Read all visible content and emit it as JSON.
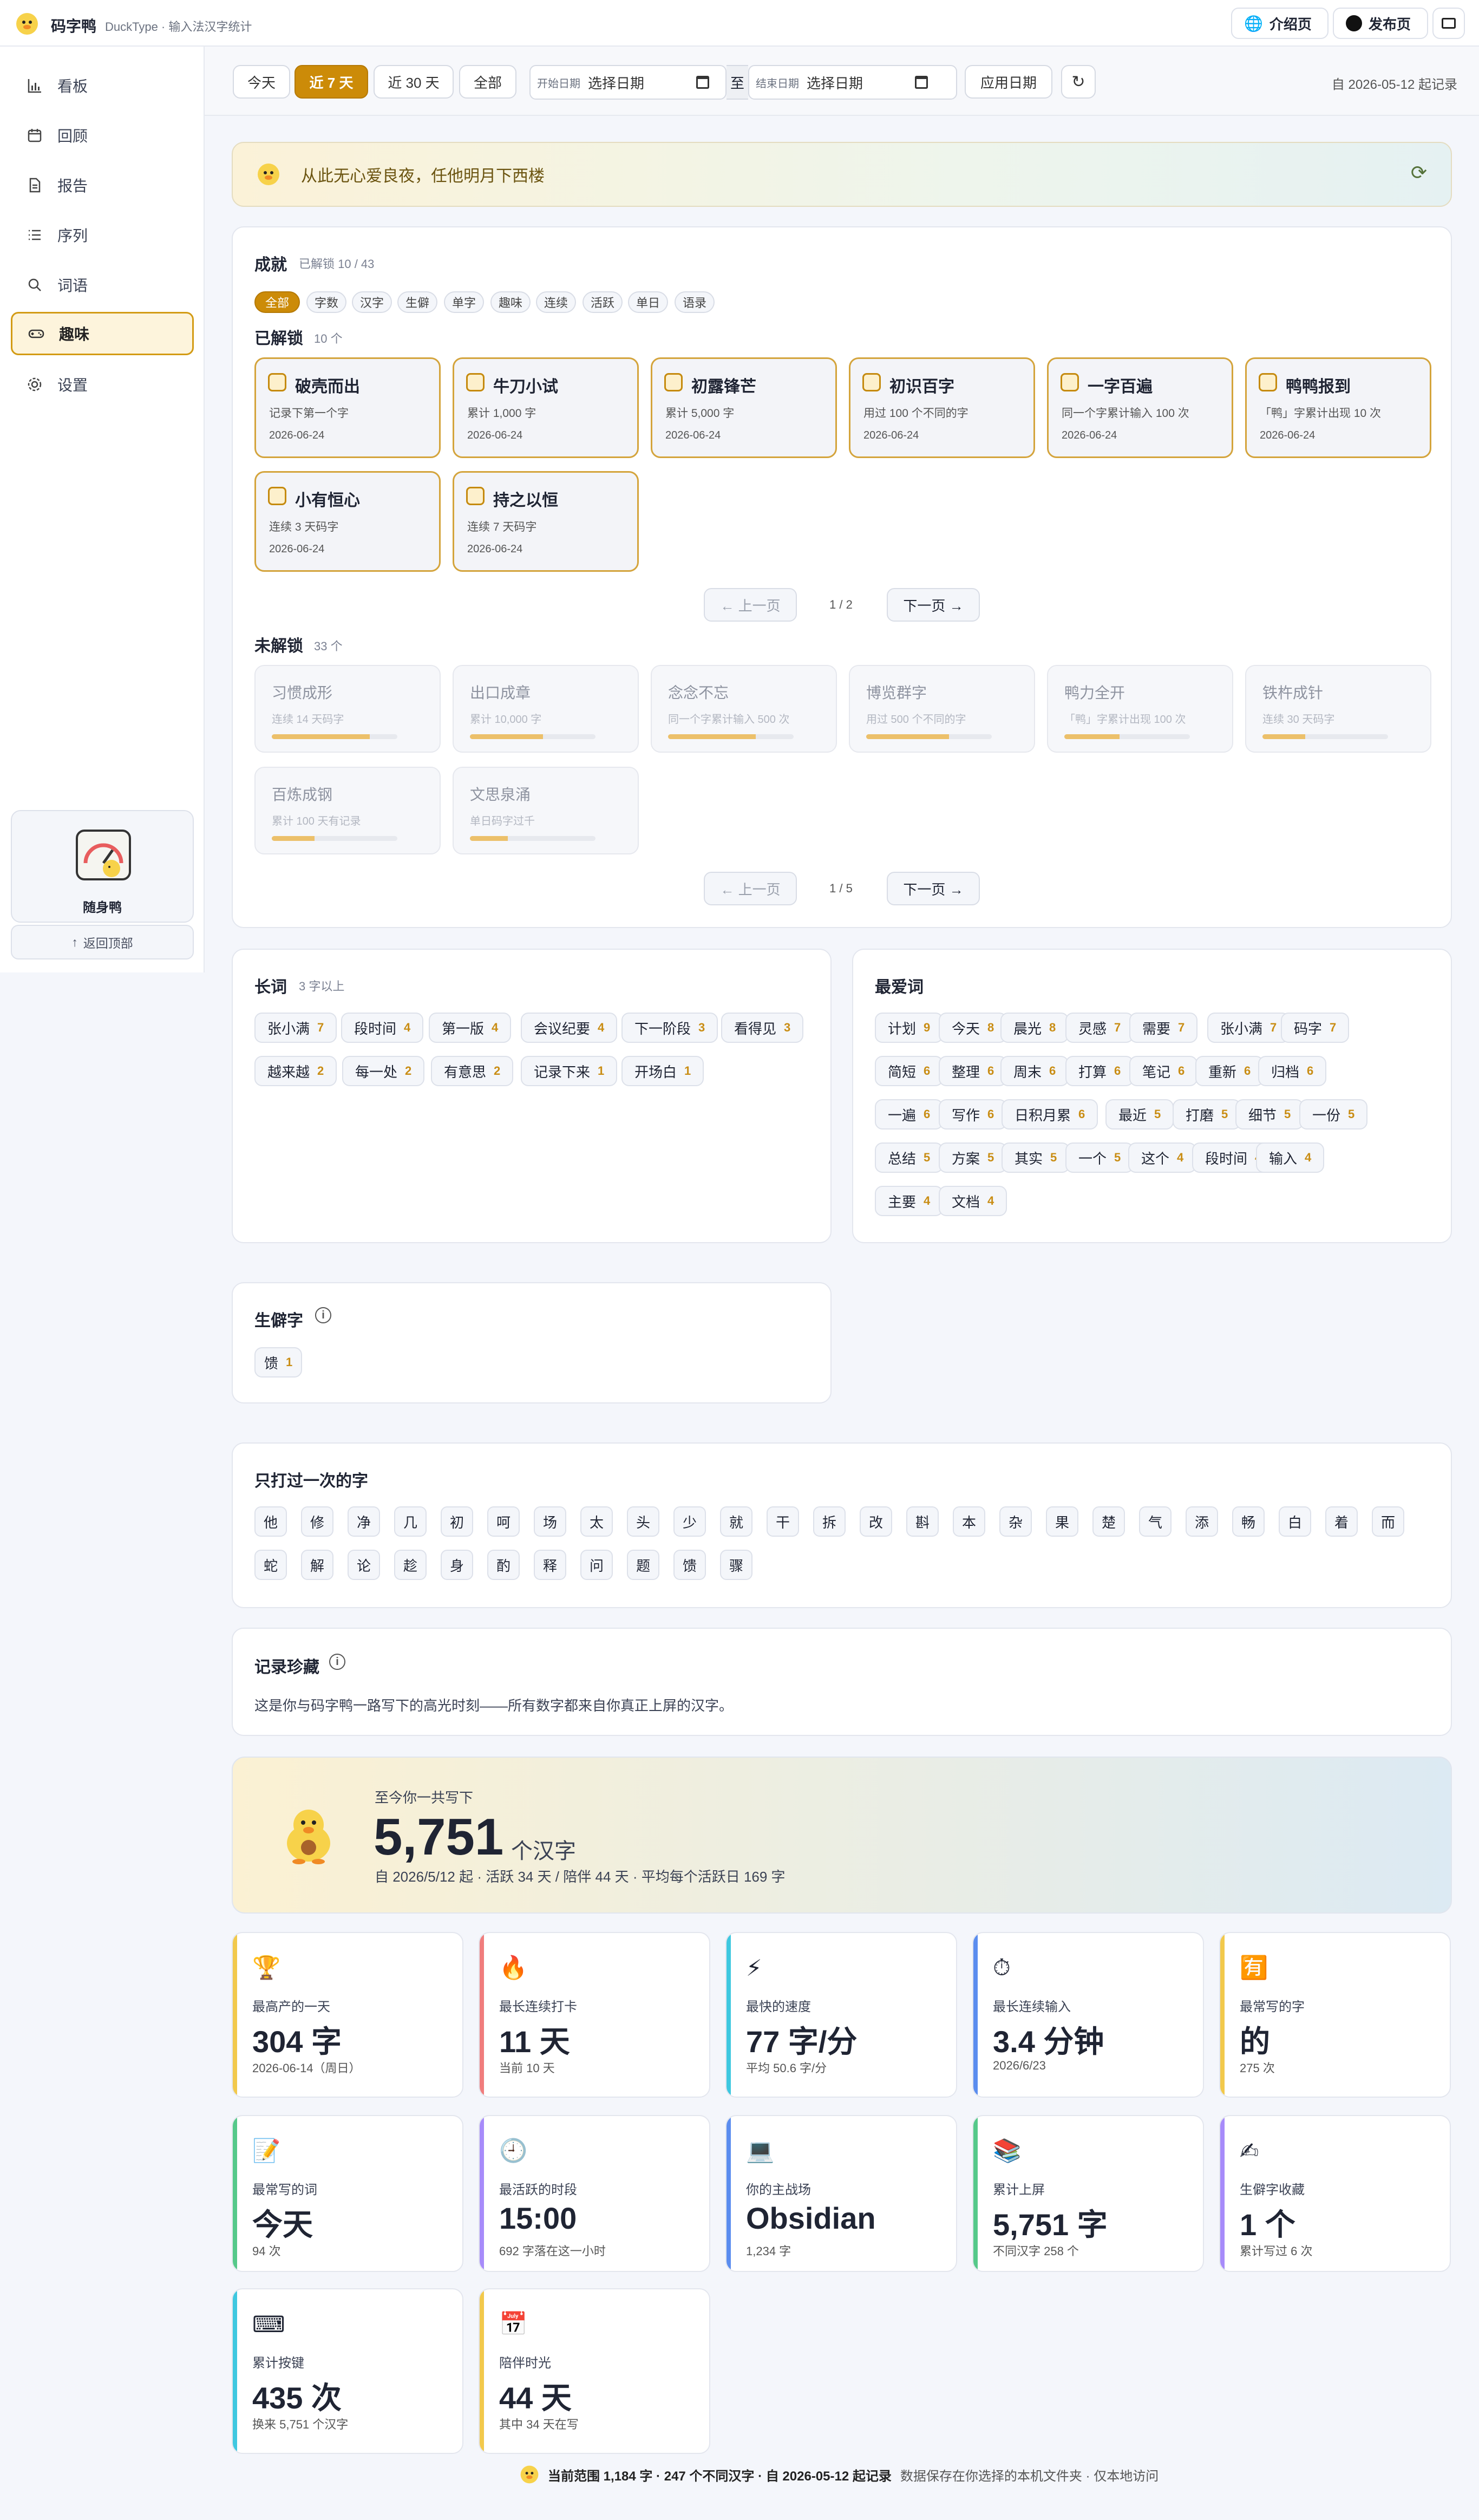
{
  "app": {
    "title": "码字鸭",
    "subtitle": "DuckType · 输入法汉字统计"
  },
  "topbar": {
    "intro_label": "介绍页",
    "release_label": "发布页"
  },
  "sidebar": {
    "items": [
      {
        "label": "看板",
        "icon": "bar-chart-icon"
      },
      {
        "label": "回顾",
        "icon": "calendar-icon"
      },
      {
        "label": "报告",
        "icon": "document-icon"
      },
      {
        "label": "序列",
        "icon": "list-icon"
      },
      {
        "label": "词语",
        "icon": "search-icon"
      },
      {
        "label": "趣味",
        "icon": "gamepad-icon"
      },
      {
        "label": "设置",
        "icon": "gear-icon"
      }
    ],
    "active": "趣味",
    "duck_card_label": "随身鸭",
    "back_top_label": "返回顶部"
  },
  "filters": {
    "buttons": [
      "今天",
      "近 7 天",
      "近 30 天",
      "全部"
    ],
    "active": "近 7 天",
    "start_label": "开始日期",
    "start_value": "选择日期",
    "sep": "至",
    "end_label": "结束日期",
    "end_value": "选择日期",
    "apply_label": "应用日期",
    "since": "自 2026-05-12 起记录"
  },
  "quote": "从此无心爱良夜，任他明月下西楼",
  "achievements": {
    "title": "成就",
    "summary": "已解锁 10 / 43",
    "tags": [
      "全部",
      "字数",
      "汉字",
      "生僻",
      "单字",
      "趣味",
      "连续",
      "活跃",
      "单日",
      "语录"
    ],
    "unlocked_title": "已解锁",
    "unlocked_count": "10 个",
    "unlocked": [
      {
        "title": "破壳而出",
        "desc": "记录下第一个字",
        "date": "2026-06-24"
      },
      {
        "title": "牛刀小试",
        "desc": "累计 1,000 字",
        "date": "2026-06-24"
      },
      {
        "title": "初露锋芒",
        "desc": "累计 5,000 字",
        "date": "2026-06-24"
      },
      {
        "title": "初识百字",
        "desc": "用过 100 个不同的字",
        "date": "2026-06-24"
      },
      {
        "title": "一字百遍",
        "desc": "同一个字累计输入 100 次",
        "date": "2026-06-24"
      },
      {
        "title": "鸭鸭报到",
        "desc": "「鸭」字累计出现 10 次",
        "date": "2026-06-24"
      },
      {
        "title": "小有恒心",
        "desc": "连续 3 天码字",
        "date": "2026-06-24"
      },
      {
        "title": "持之以恒",
        "desc": "连续 7 天码字",
        "date": "2026-06-24"
      }
    ],
    "unlocked_page": "1 / 2",
    "locked_title": "未解锁",
    "locked_count": "33 个",
    "locked": [
      {
        "title": "习惯成形",
        "desc": "连续 14 天码字",
        "progress": 0.78
      },
      {
        "title": "出口成章",
        "desc": "累计 10,000 字",
        "progress": 0.58
      },
      {
        "title": "念念不忘",
        "desc": "同一个字累计输入 500 次",
        "progress": 0.7
      },
      {
        "title": "博览群字",
        "desc": "用过 500 个不同的字",
        "progress": 0.66
      },
      {
        "title": "鸭力全开",
        "desc": "「鸭」字累计出现 100 次",
        "progress": 0.44
      },
      {
        "title": "铁杵成针",
        "desc": "连续 30 天码字",
        "progress": 0.34
      },
      {
        "title": "百炼成钢",
        "desc": "累计 100 天有记录",
        "progress": 0.34
      },
      {
        "title": "文思泉涌",
        "desc": "单日码字过千",
        "progress": 0.3
      }
    ],
    "locked_page": "1 / 5",
    "prev_label": "← 上一页",
    "next_label": "下一页 →"
  },
  "long_words": {
    "title": "长词",
    "subtitle": "3 字以上",
    "items": [
      {
        "w": "张小满",
        "n": "7"
      },
      {
        "w": "段时间",
        "n": "4"
      },
      {
        "w": "第一版",
        "n": "4"
      },
      {
        "w": "会议纪要",
        "n": "4"
      },
      {
        "w": "下一阶段",
        "n": "3"
      },
      {
        "w": "看得见",
        "n": "3"
      },
      {
        "w": "越来越",
        "n": "2"
      },
      {
        "w": "每一处",
        "n": "2"
      },
      {
        "w": "有意思",
        "n": "2"
      },
      {
        "w": "记录下来",
        "n": "1"
      },
      {
        "w": "开场白",
        "n": "1"
      }
    ]
  },
  "fav_words": {
    "title": "最爱词",
    "items": [
      {
        "w": "计划",
        "n": "9"
      },
      {
        "w": "今天",
        "n": "8"
      },
      {
        "w": "晨光",
        "n": "8"
      },
      {
        "w": "灵感",
        "n": "7"
      },
      {
        "w": "需要",
        "n": "7"
      },
      {
        "w": "张小满",
        "n": "7"
      },
      {
        "w": "码字",
        "n": "7"
      },
      {
        "w": "简短",
        "n": "6"
      },
      {
        "w": "整理",
        "n": "6"
      },
      {
        "w": "周末",
        "n": "6"
      },
      {
        "w": "打算",
        "n": "6"
      },
      {
        "w": "笔记",
        "n": "6"
      },
      {
        "w": "重新",
        "n": "6"
      },
      {
        "w": "归档",
        "n": "6"
      },
      {
        "w": "一遍",
        "n": "6"
      },
      {
        "w": "写作",
        "n": "6"
      },
      {
        "w": "日积月累",
        "n": "6"
      },
      {
        "w": "最近",
        "n": "5"
      },
      {
        "w": "打磨",
        "n": "5"
      },
      {
        "w": "细节",
        "n": "5"
      },
      {
        "w": "一份",
        "n": "5"
      },
      {
        "w": "总结",
        "n": "5"
      },
      {
        "w": "方案",
        "n": "5"
      },
      {
        "w": "其实",
        "n": "5"
      },
      {
        "w": "一个",
        "n": "5"
      },
      {
        "w": "这个",
        "n": "4"
      },
      {
        "w": "段时间",
        "n": "4"
      },
      {
        "w": "输入",
        "n": "4"
      },
      {
        "w": "主要",
        "n": "4"
      },
      {
        "w": "文档",
        "n": "4"
      }
    ]
  },
  "rare": {
    "title": "生僻字",
    "items": [
      {
        "w": "馈",
        "n": "1"
      }
    ]
  },
  "once": {
    "title": "只打过一次的字",
    "chars": [
      "他",
      "修",
      "净",
      "几",
      "初",
      "呵",
      "场",
      "太",
      "头",
      "少",
      "就",
      "干",
      "拆",
      "改",
      "斟",
      "本",
      "杂",
      "果",
      "楚",
      "气",
      "添",
      "畅",
      "白",
      "着",
      "而",
      "蛇",
      "解",
      "论",
      "趁",
      "身",
      "酌",
      "释",
      "问",
      "题",
      "馈",
      "骤"
    ]
  },
  "records": {
    "title": "记录珍藏",
    "desc": "这是你与码字鸭一路写下的高光时刻——所有数字都来自你真正上屏的汉字。",
    "hero_label": "至今你一共写下",
    "hero_value": "5,751",
    "hero_unit": "个汉字",
    "hero_sub": "自 2026/5/12 起 · 活跃 34 天 / 陪伴 44 天 · 平均每个活跃日 169 字",
    "stats": [
      {
        "icon": "🏆",
        "label": "最高产的一天",
        "value": "304 字",
        "sub": "2026-06-14（周日）",
        "color": "#f2c94c"
      },
      {
        "icon": "🔥",
        "label": "最长连续打卡",
        "value": "11 天",
        "sub": "当前 10 天",
        "color": "#f07d7d"
      },
      {
        "icon": "⚡",
        "label": "最快的速度",
        "value": "77 字/分",
        "sub": "平均 50.6 字/分",
        "color": "#3fc8e0"
      },
      {
        "icon": "⏱",
        "label": "最长连续输入",
        "value": "3.4 分钟",
        "sub": "2026/6/23",
        "color": "#5b8def"
      },
      {
        "icon": "🈶",
        "label": "最常写的字",
        "value": "的",
        "sub": "275 次",
        "color": "#f2c94c"
      },
      {
        "icon": "📝",
        "label": "最常写的词",
        "value": "今天",
        "sub": "94 次",
        "color": "#56c98a"
      },
      {
        "icon": "🕘",
        "label": "最活跃的时段",
        "value": "15:00",
        "sub": "692 字落在这一小时",
        "color": "#a78bfa"
      },
      {
        "icon": "💻",
        "label": "你的主战场",
        "value": "Obsidian",
        "sub": "1,234 字",
        "color": "#5b8def"
      },
      {
        "icon": "📚",
        "label": "累计上屏",
        "value": "5,751 字",
        "sub": "不同汉字 258 个",
        "color": "#56c98a"
      },
      {
        "icon": "✍",
        "label": "生僻字收藏",
        "value": "1 个",
        "sub": "累计写过 6 次",
        "color": "#a78bfa"
      },
      {
        "icon": "⌨",
        "label": "累计按键",
        "value": "435 次",
        "sub": "换来 5,751 个汉字",
        "color": "#3fc8e0"
      },
      {
        "icon": "📅",
        "label": "陪伴时光",
        "value": "44 天",
        "sub": "其中 34 天在写",
        "color": "#f2c94c"
      }
    ]
  },
  "footer": {
    "main": "当前范围 1,184 字 · 247 个不同汉字 · 自 2026-05-12 起记录",
    "note": "数据保存在你选择的本机文件夹 · 仅本地访问"
  }
}
